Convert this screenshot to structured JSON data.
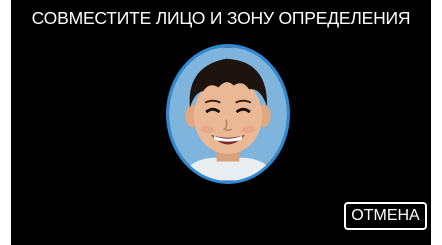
{
  "screen": {
    "instruction": "СОВМЕСТИТЕ ЛИЦО И ЗОНУ ОПРЕДЕЛЕНИЯ",
    "cancel_label": "ОТМЕНА"
  },
  "colors": {
    "background": "#000000",
    "text": "#ffffff",
    "detection_frame": "#2f8ad4"
  },
  "icons": {
    "face_photo": "child-face-photo"
  }
}
